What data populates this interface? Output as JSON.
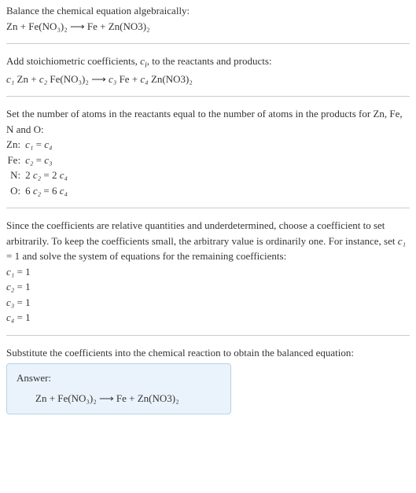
{
  "s1": {
    "line1": "Balance the chemical equation algebraically:",
    "eq": "Zn + Fe(NO₃)₂  ⟶  Fe + Zn(NO3)₂"
  },
  "s2": {
    "line1_a": "Add stoichiometric coefficients, ",
    "line1_ci": "c",
    "line1_i": "i",
    "line1_b": ", to the reactants and products:",
    "eq_c1": "c₁",
    "eq_r1": " Zn + ",
    "eq_c2": "c₂",
    "eq_r2": " Fe(NO₃)₂  ⟶  ",
    "eq_c3": "c₃",
    "eq_r3": " Fe + ",
    "eq_c4": "c₄",
    "eq_r4": " Zn(NO3)₂"
  },
  "s3": {
    "line1": "Set the number of atoms in the reactants equal to the number of atoms in the products for Zn, Fe, N and O:",
    "rows": [
      {
        "el": "Zn:",
        "lhs_c": "c₁",
        "mid": " = ",
        "rhs_c": "c₄"
      },
      {
        "el": "Fe:",
        "lhs_c": "c₂",
        "mid": " = ",
        "rhs_c": "c₃"
      },
      {
        "el": "N:",
        "lhs_pre": "2 ",
        "lhs_c": "c₂",
        "mid": " = 2 ",
        "rhs_c": "c₄"
      },
      {
        "el": "O:",
        "lhs_pre": "6 ",
        "lhs_c": "c₂",
        "mid": " = 6 ",
        "rhs_c": "c₄"
      }
    ]
  },
  "s4": {
    "para_a": "Since the coefficients are relative quantities and underdetermined, choose a coefficient to set arbitrarily. To keep the coefficients small, the arbitrary value is ordinarily one. For instance, set ",
    "para_c1": "c₁",
    "para_b": " = 1 and solve the system of equations for the remaining coefficients:",
    "rows": [
      {
        "c": "c₁",
        "v": " = 1"
      },
      {
        "c": "c₂",
        "v": " = 1"
      },
      {
        "c": "c₃",
        "v": " = 1"
      },
      {
        "c": "c₄",
        "v": " = 1"
      }
    ]
  },
  "s5": {
    "line1": "Substitute the coefficients into the chemical reaction to obtain the balanced equation:",
    "answer_label": "Answer:",
    "answer_eq": "Zn + Fe(NO₃)₂  ⟶  Fe + Zn(NO3)₂"
  }
}
